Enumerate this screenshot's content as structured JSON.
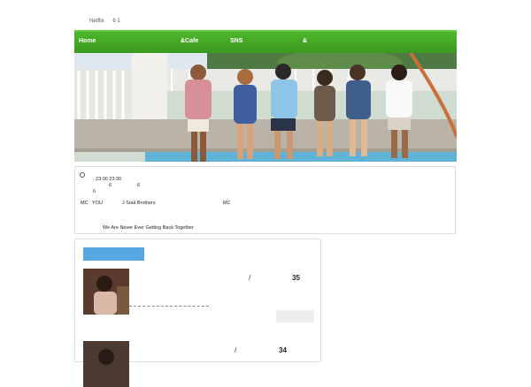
{
  "top": {
    "brand": "Netflix",
    "extra": "6 1"
  },
  "nav": [
    {
      "label": "Home"
    },
    {
      "label": "&Cafe"
    },
    {
      "label": "SNS"
    },
    {
      "label": "&"
    }
  ],
  "info": {
    "time": ": 23:00 23:30",
    "line2a": "6",
    "line2b": "6",
    "line3": "6",
    "mc_label": "MC",
    "mc_name": "YOU",
    "group": "J Soul Brothers",
    "mc2": "MC",
    "song": "We Are Never Ever Getting Back Together"
  },
  "articles": [
    {
      "slash": "/",
      "num": "35"
    },
    {
      "slash": "/",
      "num": "34"
    }
  ],
  "colors": {
    "nav_green": "#3fa822",
    "blue_bar": "#55a8e0"
  }
}
